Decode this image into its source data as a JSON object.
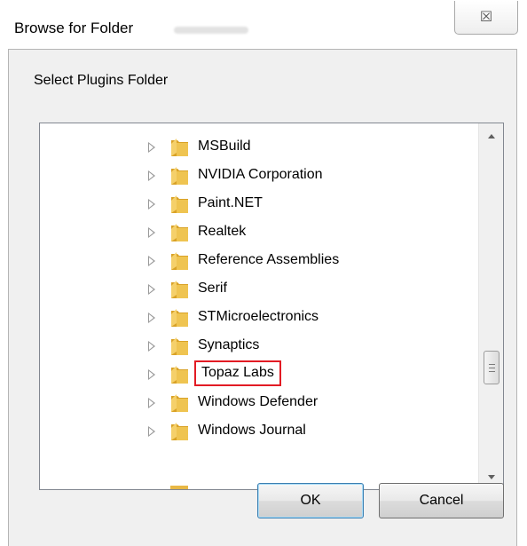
{
  "window": {
    "title": "Browse for Folder",
    "close_glyph": "☒"
  },
  "prompt": "Select Plugins Folder",
  "tree": {
    "items": [
      {
        "label": "MSBuild",
        "selected": false
      },
      {
        "label": "NVIDIA Corporation",
        "selected": false
      },
      {
        "label": "Paint.NET",
        "selected": false
      },
      {
        "label": "Realtek",
        "selected": false
      },
      {
        "label": "Reference Assemblies",
        "selected": false
      },
      {
        "label": "Serif",
        "selected": false
      },
      {
        "label": "STMicroelectronics",
        "selected": false
      },
      {
        "label": "Synaptics",
        "selected": false
      },
      {
        "label": "Topaz Labs",
        "selected": true
      },
      {
        "label": "Windows Defender",
        "selected": false
      },
      {
        "label": "Windows Journal",
        "selected": false
      }
    ],
    "scroll_position": 0.72
  },
  "buttons": {
    "ok": "OK",
    "cancel": "Cancel"
  },
  "colors": {
    "highlight": "#e21b24",
    "dialog_bg": "#f0f0f0"
  },
  "icons": {
    "folder": "folder-icon",
    "expander": "expand-triangle-icon",
    "close": "close-icon"
  }
}
